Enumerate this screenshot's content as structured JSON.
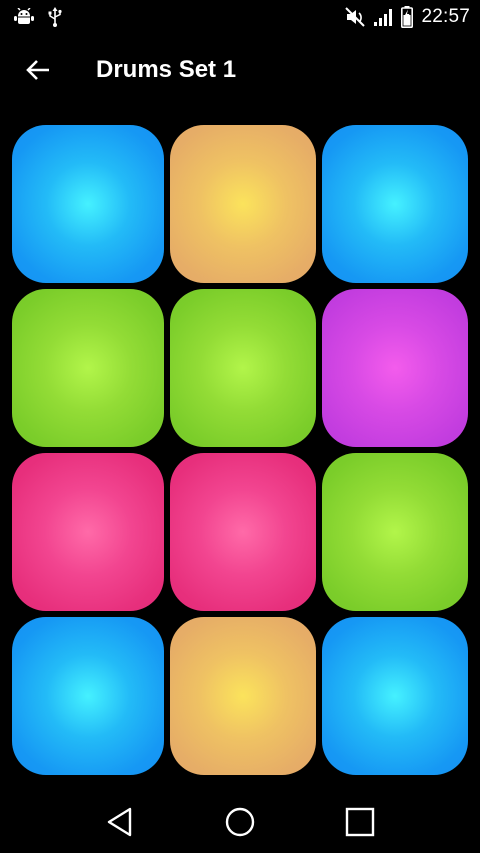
{
  "status_bar": {
    "time": "22:57",
    "left_icons": [
      "android-debug-icon",
      "usb-icon"
    ],
    "right_icons": [
      "mute-icon",
      "signal-icon",
      "battery-icon"
    ]
  },
  "app_bar": {
    "title": "Drums Set 1",
    "back_icon": "arrow-left-icon"
  },
  "pads": [
    {
      "color": "blue",
      "hex": "#1698f4"
    },
    {
      "color": "orange",
      "hex": "#e6ad67"
    },
    {
      "color": "blue",
      "hex": "#1698f4"
    },
    {
      "color": "green",
      "hex": "#7bcd2a"
    },
    {
      "color": "green",
      "hex": "#7bcd2a"
    },
    {
      "color": "purple",
      "hex": "#c33ddf"
    },
    {
      "color": "pink",
      "hex": "#e72f7c"
    },
    {
      "color": "pink",
      "hex": "#e72f7c"
    },
    {
      "color": "green",
      "hex": "#7bcd2a"
    },
    {
      "color": "blue",
      "hex": "#1698f4"
    },
    {
      "color": "orange",
      "hex": "#e6ad67"
    },
    {
      "color": "blue",
      "hex": "#1698f4"
    }
  ],
  "nav_bar": {
    "buttons": [
      "back-triangle-icon",
      "home-circle-icon",
      "recents-square-icon"
    ]
  }
}
